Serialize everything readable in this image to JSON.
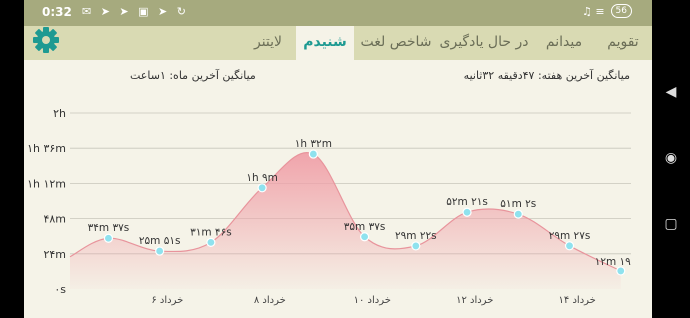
{
  "status_bar": {
    "time": "0:32",
    "left_icons": "✉ ➤ ➤ ▣ ➤ ↻",
    "right_icons": "♫ ≡",
    "battery": "56"
  },
  "tabs": [
    {
      "label": "تقویم"
    },
    {
      "label": "میدانم"
    },
    {
      "label": "در حال یادگیری"
    },
    {
      "label": "شاخص لغت"
    },
    {
      "label": "شنیدم"
    },
    {
      "label": "لایتنر"
    }
  ],
  "active_tab": "شنیدم",
  "summary": {
    "week_avg": "میانگین آخرین هفته: ۴۷دقیقه ۳۲ثانیه",
    "month_avg": "میانگین آخرین ماه: ۱ساعت"
  },
  "colors": {
    "accent": "#1e9a92",
    "fill": "#f0a0a8",
    "point": "#8fe2ee",
    "tab_bar": "#d9dab3",
    "status_bar": "#a6aa7e"
  },
  "chart_data": {
    "type": "area",
    "y_unit": "minutes",
    "ylim": [
      0,
      120
    ],
    "y_ticks": [
      {
        "value": 0,
        "label": "۰s"
      },
      {
        "value": 24,
        "label": "۲۴m"
      },
      {
        "value": 48,
        "label": "۴۸m"
      },
      {
        "value": 72,
        "label": "۱h ۱۲m"
      },
      {
        "value": 96,
        "label": "۱h ۳۶m"
      },
      {
        "value": 120,
        "label": "۲h"
      }
    ],
    "x_ticks": [
      {
        "x": 6,
        "label": "۶ خرداد"
      },
      {
        "x": 8,
        "label": "۸ خرداد"
      },
      {
        "x": 10,
        "label": "۱۰ خرداد"
      },
      {
        "x": 12,
        "label": "۱۲ خرداد"
      },
      {
        "x": 14,
        "label": "۱۴ خرداد"
      }
    ],
    "x_range": [
      4.1,
      15.05
    ],
    "series": [
      {
        "points": [
          {
            "x": 4.85,
            "y": 34.62,
            "label": "۳۴m ۳۷s"
          },
          {
            "x": 5.85,
            "y": 25.85,
            "label": "۲۵m ۵۱s"
          },
          {
            "x": 6.85,
            "y": 31.77,
            "label": "۳۱m ۴۶s"
          },
          {
            "x": 7.85,
            "y": 69,
            "label": "۱h ۹m"
          },
          {
            "x": 8.85,
            "y": 92,
            "label": "۱h ۳۲m"
          },
          {
            "x": 9.85,
            "y": 35.62,
            "label": "۳۵m ۳۷s"
          },
          {
            "x": 10.85,
            "y": 29.37,
            "label": "۲۹m ۲۲s"
          },
          {
            "x": 11.85,
            "y": 52.35,
            "label": "۵۲m ۲۱s"
          },
          {
            "x": 12.85,
            "y": 51.03,
            "label": "۵۱m ۲s"
          },
          {
            "x": 13.85,
            "y": 29.45,
            "label": "۲۹m ۲۷s"
          },
          {
            "x": 14.85,
            "y": 12.32,
            "label": "۱۲m ۱۹"
          }
        ]
      }
    ]
  },
  "nav": {
    "back": "◀",
    "home": "◉",
    "recent": "▢"
  }
}
